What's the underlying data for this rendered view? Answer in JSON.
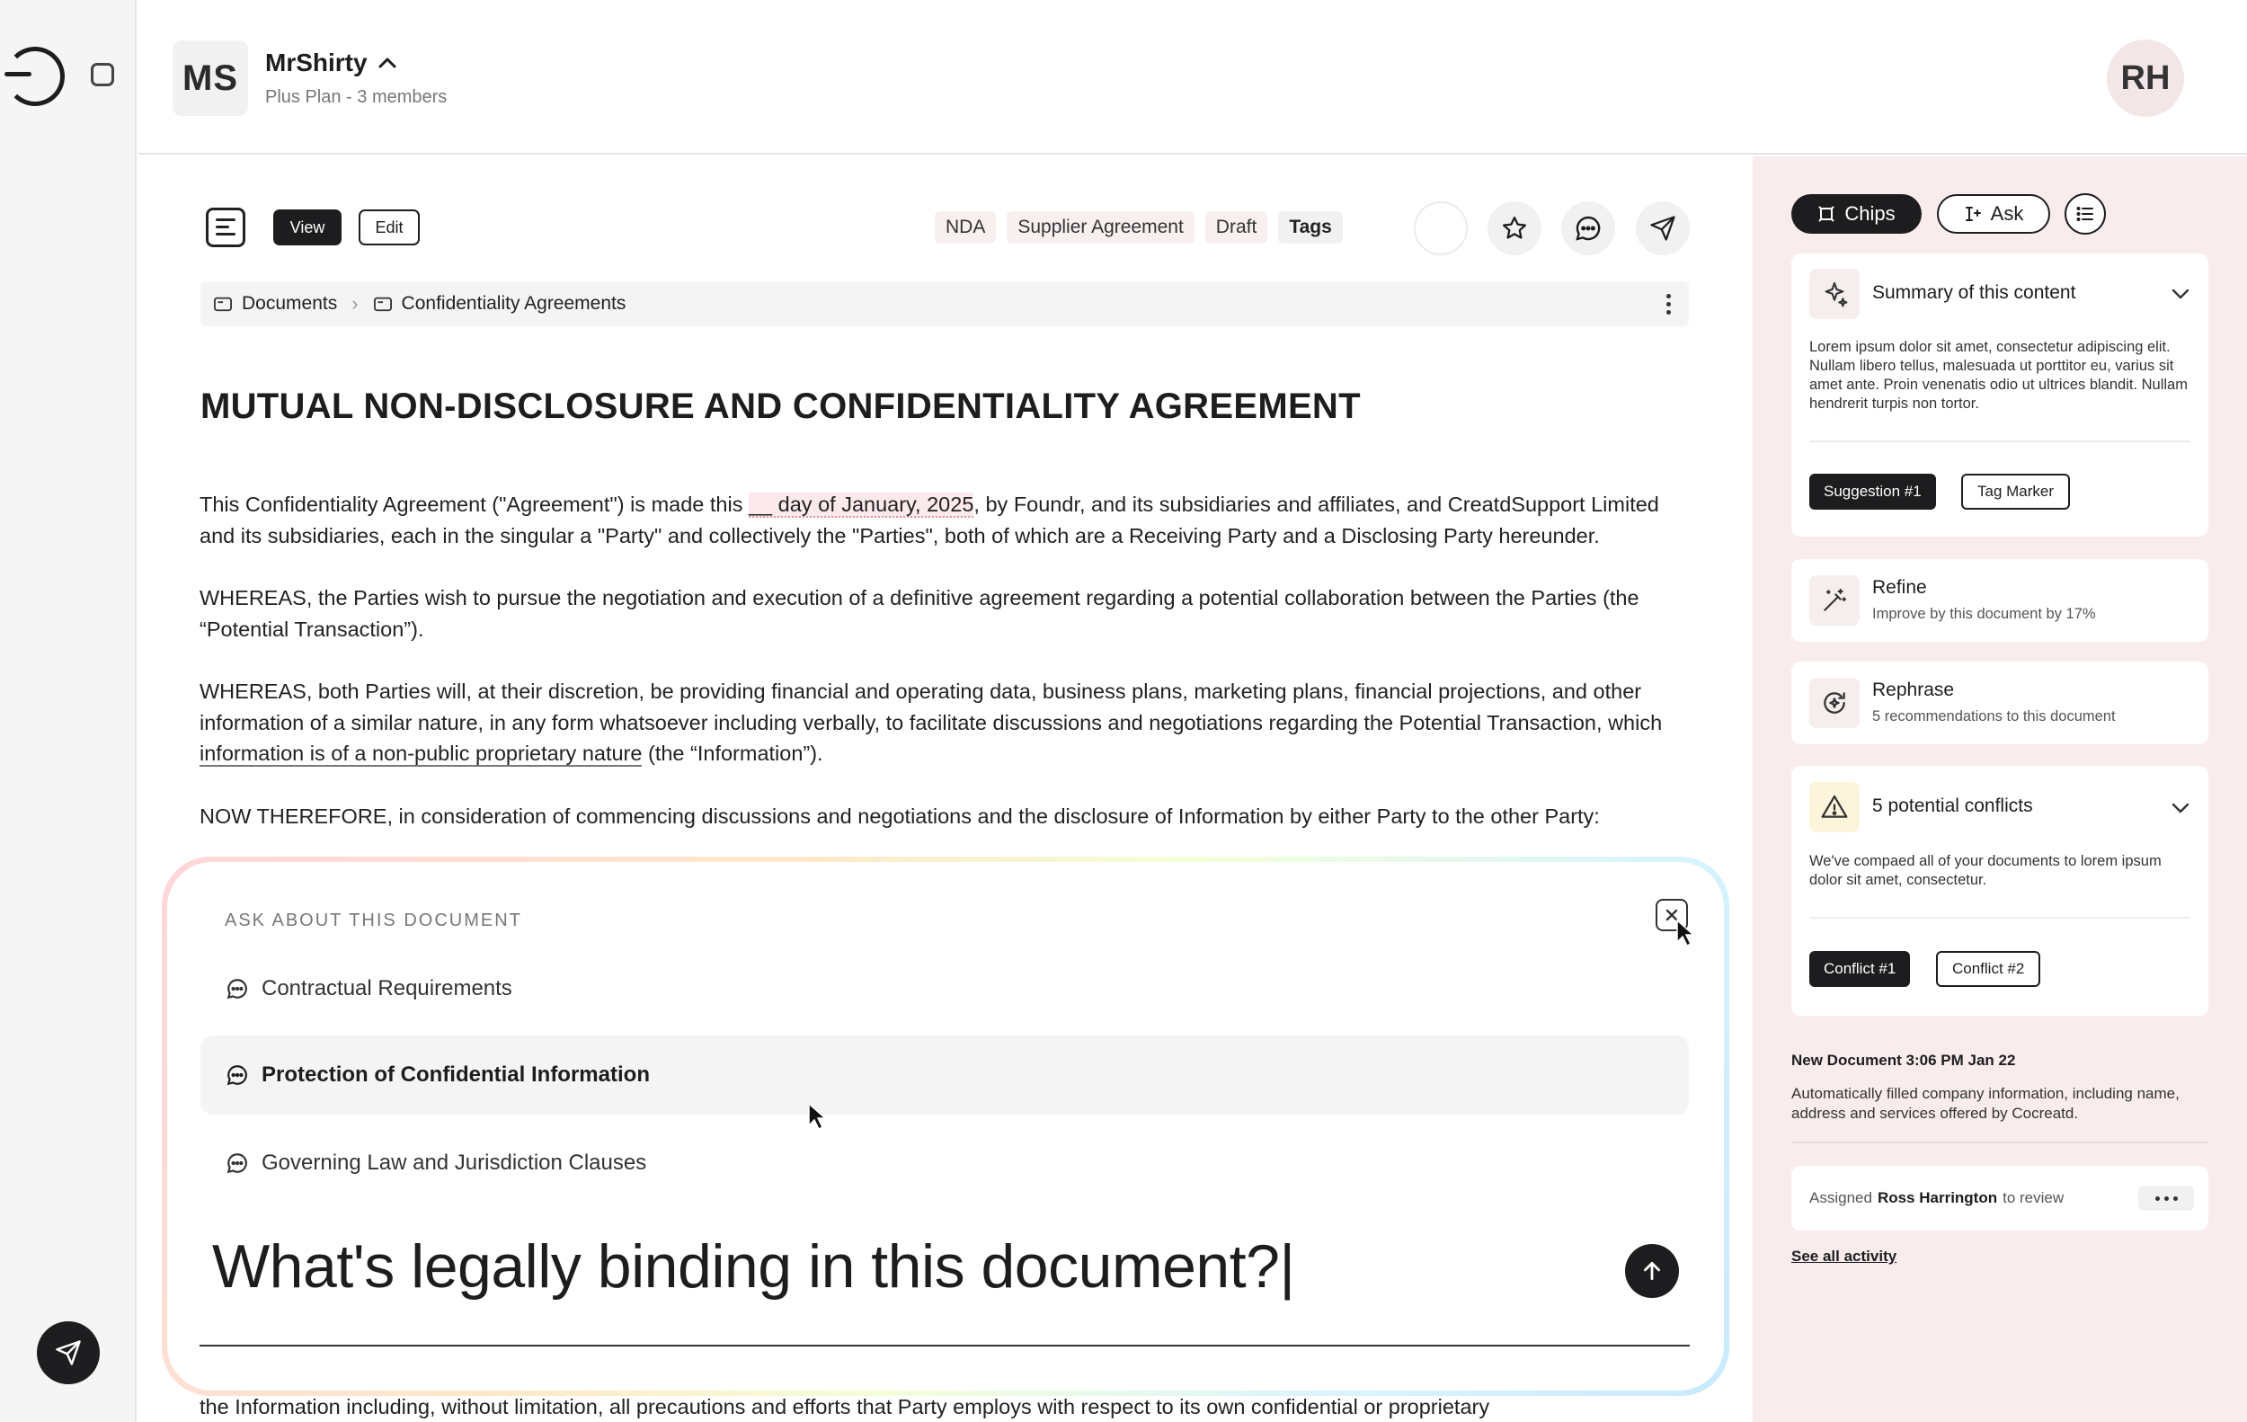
{
  "workspace": {
    "initials": "MS",
    "name": "MrShirty",
    "plan": "Plus Plan - 3 members"
  },
  "user": {
    "initials": "RH"
  },
  "toolbar": {
    "view_label": "View",
    "edit_label": "Edit",
    "tags": [
      "NDA",
      "Supplier Agreement",
      "Draft"
    ],
    "tags_label": "Tags"
  },
  "breadcrumb": {
    "items": [
      "Documents",
      "Confidentiality Agreements"
    ]
  },
  "document": {
    "title": "MUTUAL NON-DISCLOSURE AND CONFIDENTIALITY AGREEMENT",
    "p1": {
      "before": "This Confidentiality Agreement (\"Agreement\") is made this ",
      "highlight": "__ day of January, 2025",
      "after": ", by Foundr, and its subsidiaries and affiliates, and CreatdSupport Limited and its subsidiaries, each in the singular a \"Party\" and collectively the \"Parties\", both of which are a Receiving Party and a Disclosing Party hereunder."
    },
    "p2": "WHEREAS, the Parties wish to pursue the negotiation and execution of a definitive agreement regarding a potential collaboration between the Parties (the “Potential Transaction”).",
    "p3": {
      "before": "WHEREAS, both Parties will, at their discretion, be providing financial and operating data, business plans, marketing plans, financial projections, and other information of a similar nature, in any form whatsoever including verbally, to facilitate discussions and negotiations regarding the Potential Transaction, which ",
      "underlined": "information is of a non-public proprietary nature",
      "after": " (the “Information”)."
    },
    "p4": "NOW THEREFORE, in consideration of commencing discussions and negotiations and the disclosure of Information by either Party to the other Party:",
    "footer_line": "the Information including, without limitation, all precautions and efforts that Party employs with respect to its own confidential or proprietary"
  },
  "ask": {
    "label": "ASK ABOUT THIS DOCUMENT",
    "suggestions": [
      "Contractual Requirements",
      "Protection of Confidential Information",
      "Governing Law and Jurisdiction Clauses"
    ],
    "input_value": "What's legally binding in this document?|"
  },
  "panel": {
    "tab_chips": "Chips",
    "tab_ask": "Ask",
    "summary": {
      "title": "Summary of this content",
      "text": "Lorem ipsum dolor sit amet, consectetur adipiscing elit. Nullam libero tellus, malesuada ut porttitor eu, varius sit amet ante. Proin venenatis odio ut ultrices blandit. Nullam hendrerit turpis non tortor.",
      "chips": [
        "Suggestion #1",
        "Tag Marker"
      ]
    },
    "refine": {
      "title": "Refine",
      "sub": "Improve by this document by 17%"
    },
    "rephrase": {
      "title": "Rephrase",
      "sub": "5 recommendations to this document"
    },
    "conflicts": {
      "title": "5 potential conflicts",
      "text": "We've compaed all of your documents to lorem ipsum dolor sit amet, consectetur.",
      "chips": [
        "Conflict #1",
        "Conflict #2"
      ]
    },
    "activity": {
      "title": "New Document 3:06 PM Jan 22",
      "text": "Automatically filled company information, including name, address and services offered by Cocreatd.",
      "assign_prefix": "Assigned",
      "assign_name": "Ross Harrington",
      "assign_suffix": "to review",
      "see_all": "See all activity"
    }
  },
  "colors": {
    "accent_dark": "#1d1d1f",
    "panel_bg": "#f8ecec",
    "highlight": "#fbe9ec"
  }
}
